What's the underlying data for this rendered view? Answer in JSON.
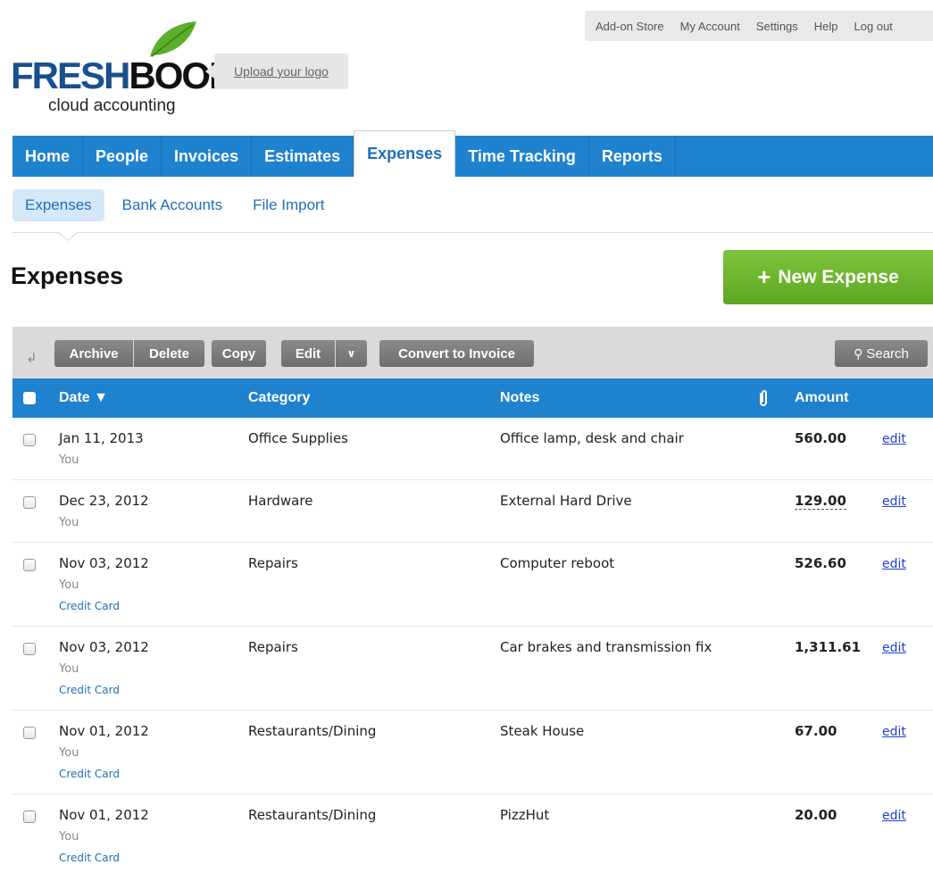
{
  "topbar": {
    "links": [
      "Add-on Store",
      "My Account",
      "Settings",
      "Help",
      "Log out"
    ]
  },
  "logo": {
    "word_fresh": "FRESH",
    "word_books": "BOOKS",
    "tagline": "cloud accounting",
    "upload": "Upload your logo"
  },
  "nav": {
    "items": [
      "Home",
      "People",
      "Invoices",
      "Estimates",
      "Expenses",
      "Time Tracking",
      "Reports"
    ],
    "active": "Expenses"
  },
  "subnav": {
    "items": [
      "Expenses",
      "Bank Accounts",
      "File Import"
    ],
    "active": "Expenses"
  },
  "page": {
    "title": "Expenses",
    "new_button": "New Expense"
  },
  "toolbar": {
    "archive": "Archive",
    "delete": "Delete",
    "copy": "Copy",
    "edit": "Edit",
    "edit_dropdown": "∨",
    "convert": "Convert to Invoice",
    "search": "Search"
  },
  "table": {
    "headers": {
      "date": "Date ▼",
      "category": "Category",
      "notes": "Notes",
      "amount": "Amount"
    },
    "rows": [
      {
        "date": "Jan 11, 2013",
        "by": "You",
        "card": "",
        "category": "Office Supplies",
        "notes": "Office lamp, desk and chair",
        "amount": "560.00",
        "edit": "edit"
      },
      {
        "date": "Dec 23, 2012",
        "by": "You",
        "card": "",
        "category": "Hardware",
        "notes": "External Hard Drive",
        "amount": "129.00",
        "edit": "edit"
      },
      {
        "date": "Nov 03, 2012",
        "by": "You",
        "card": "Credit Card",
        "category": "Repairs",
        "notes": "Computer reboot",
        "amount": "526.60",
        "edit": "edit"
      },
      {
        "date": "Nov 03, 2012",
        "by": "You",
        "card": "Credit Card",
        "category": "Repairs",
        "notes": "Car brakes and transmission fix",
        "amount": "1,311.61",
        "edit": "edit"
      },
      {
        "date": "Nov 01, 2012",
        "by": "You",
        "card": "Credit Card",
        "category": "Restaurants/Dining",
        "notes": "Steak House",
        "amount": "67.00",
        "edit": "edit"
      },
      {
        "date": "Nov 01, 2012",
        "by": "You",
        "card": "Credit Card",
        "category": "Restaurants/Dining",
        "notes": "PizzHut",
        "amount": "20.00",
        "edit": "edit"
      }
    ]
  },
  "colors": {
    "nav_blue": "#1f82cf",
    "new_green": "#6bb52d",
    "link_blue": "#1f6fb8"
  }
}
